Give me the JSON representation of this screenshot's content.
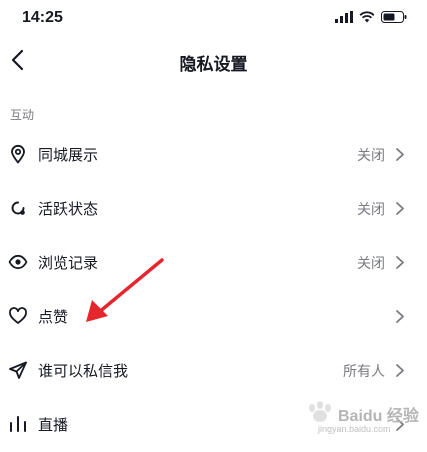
{
  "status_bar": {
    "time": "14:25"
  },
  "header": {
    "title": "隐私设置"
  },
  "section": {
    "title": "互动"
  },
  "rows": [
    {
      "label": "同城展示",
      "value": "关闭",
      "icon": "location-pin-icon"
    },
    {
      "label": "活跃状态",
      "value": "关闭",
      "icon": "active-status-icon"
    },
    {
      "label": "浏览记录",
      "value": "关闭",
      "icon": "eye-icon"
    },
    {
      "label": "点赞",
      "value": "",
      "icon": "heart-icon"
    },
    {
      "label": "谁可以私信我",
      "value": "所有人",
      "icon": "paper-plane-icon"
    },
    {
      "label": "直播",
      "value": "",
      "icon": "live-bars-icon"
    }
  ],
  "annotation": {
    "arrow_color": "#e5272d"
  },
  "watermark": {
    "brand": "Baidu 经验",
    "url": "jingyan.baidu.com"
  }
}
